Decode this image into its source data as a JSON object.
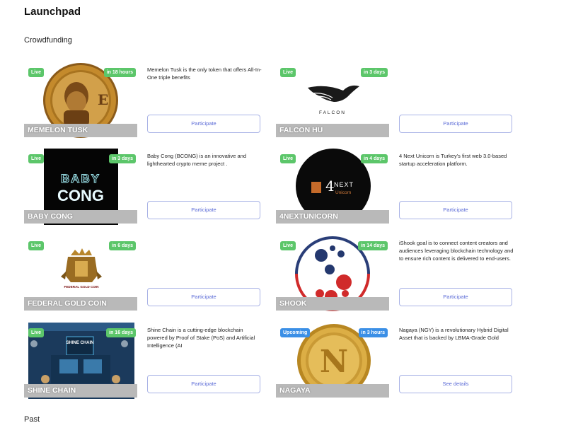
{
  "page": {
    "title": "Launchpad"
  },
  "sections": {
    "crowdfunding": "Crowdfunding",
    "past": "Past"
  },
  "cards": [
    {
      "name": "MEMELON TUSK",
      "status": "Live",
      "time": "in 18 hours",
      "description": "Memelon Tusk is the only token that offers All-In-One triple benefits",
      "button": "Participate"
    },
    {
      "name": "FALCON HU",
      "status": "Live",
      "time": "in 3 days",
      "description": "",
      "button": "Participate",
      "logo_text": "FALCON"
    },
    {
      "name": "BABY CONG",
      "status": "Live",
      "time": "in 3 days",
      "description": "Baby Cong (BCONG) is an innovative and lighthearted crypto meme project .",
      "button": "Participate",
      "logo_text": [
        "BABY",
        "CONG"
      ]
    },
    {
      "name": "4NEXTUNICORN",
      "status": "Live",
      "time": "in 4 days",
      "description": "4 Next Unicorn is Turkey's first web 3.0-based startup acceleration platform.",
      "button": "Participate",
      "logo_text": [
        "NEXT",
        "Unicorn"
      ]
    },
    {
      "name": "FEDERAL GOLD COIN",
      "status": "Live",
      "time": "in 6 days",
      "description": "",
      "button": "Participate",
      "logo_text": "FEDERAL GOLD COIN"
    },
    {
      "name": "SHOOK",
      "status": "Live",
      "time": "in 14 days",
      "description": "iShook goal is to connect content creators and audiences leveraging blockchain technology and to ensure rich content is delivered to end-users.",
      "button": "Participate"
    },
    {
      "name": "SHINE CHAIN",
      "status": "Live",
      "time": "in 16 days",
      "description": "Shine Chain is a cutting-edge blockchain powered by Proof of Stake (PoS) and Artificial Intelligence (AI",
      "button": "Participate",
      "logo_text": "SHINE CHAIN"
    },
    {
      "name": "NAGAYA",
      "status": "Upcoming",
      "time": "in 3 hours",
      "description": "Nagaya (NGY) is a revolutionary Hybrid Digital Asset that is backed by LBMA-Grade Gold",
      "button": "See details"
    }
  ],
  "colors": {
    "live": "#5cc66a",
    "upcoming": "#3b8fe6",
    "button_text": "#5a6ad6",
    "button_border": "#a9b3e6",
    "name_bar": "#b9b9b9"
  }
}
